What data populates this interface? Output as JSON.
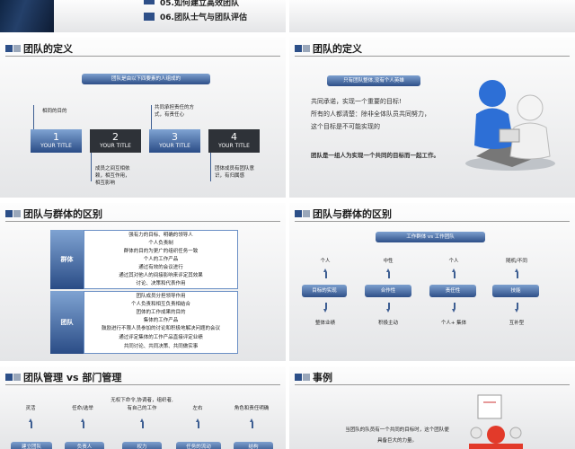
{
  "top": {
    "item5": "05.如何建立高效团队",
    "item6": "06.团队士气与团队评估"
  },
  "s1": {
    "title": "团队的定义",
    "banner": "团队是由以下四要素的人组成的",
    "notes": [
      "相同的目的",
      "共同承担责任的方式，有责任心",
      "成员之间互相依赖，相互作用，相互影响",
      "团体成员有团队意识，有归属感"
    ],
    "tiles": [
      {
        "n": "1",
        "l": "YOUR TITLE"
      },
      {
        "n": "2",
        "l": "YOUR TITLE"
      },
      {
        "n": "3",
        "l": "YOUR TITLE"
      },
      {
        "n": "4",
        "l": "YOUR TITLE"
      }
    ]
  },
  "s2": {
    "title": "团队的定义",
    "banner": "只有团队整体,没有个人英雄",
    "lines": [
      "共同承诺，实现一个重要的目标!",
      "所有的人都清楚：除非全体队员共同努力，",
      "这个目标是不可能实现的"
    ],
    "bold": "团队是一组人为实现一个共同的目标而一起工作。"
  },
  "s3": {
    "title": "团队与群体的区别",
    "group": "群体",
    "team": "团队",
    "groupLines": [
      "强有力的目标、明确的领导人",
      "个人负责制",
      "群体的目的为更广的组织任务一致",
      "个人的工作产品",
      "通过有效的会议进行",
      "通过其对他人的间接影响来评定其效果",
      "讨论、决策和代表作用"
    ],
    "teamLines": [
      "团队成员分担领导作用",
      "个人负责和相互负责相结合",
      "团体的工作成果的目的",
      "集体的工作产品",
      "鼓励进行不限人员参加的讨论和积极地解决问题的会议",
      "通过评定集体的工作产品直接评定业绩",
      "共同讨论、共同决策、共同做实事"
    ]
  },
  "s4": {
    "title": "团队与群体的区别",
    "banner": "工作群体 vs 工作团队",
    "top": [
      "个人",
      "中性",
      "个人",
      "随机/不同"
    ],
    "mid": [
      "目标的实现",
      "合作性",
      "责任性",
      "技能"
    ],
    "bot": [
      "整体业绩",
      "积极主动",
      "个人+ 集体",
      "互补型"
    ]
  },
  "s5": {
    "title": "团队管理 vs 部门管理",
    "above2": "无权下命令,协调者，组织者,",
    "top": [
      "灵活",
      "任命/选举",
      "有自己的工作",
      "左右",
      "角色和责任明确"
    ],
    "bars": [
      "建立团队",
      "负责人",
      "权力",
      "任务的流动",
      "结构"
    ]
  },
  "s6": {
    "title": "事例",
    "text1": "当团队的队员有一个共同的目标时，这个团队便",
    "text2": "具备巨大的力量。"
  }
}
